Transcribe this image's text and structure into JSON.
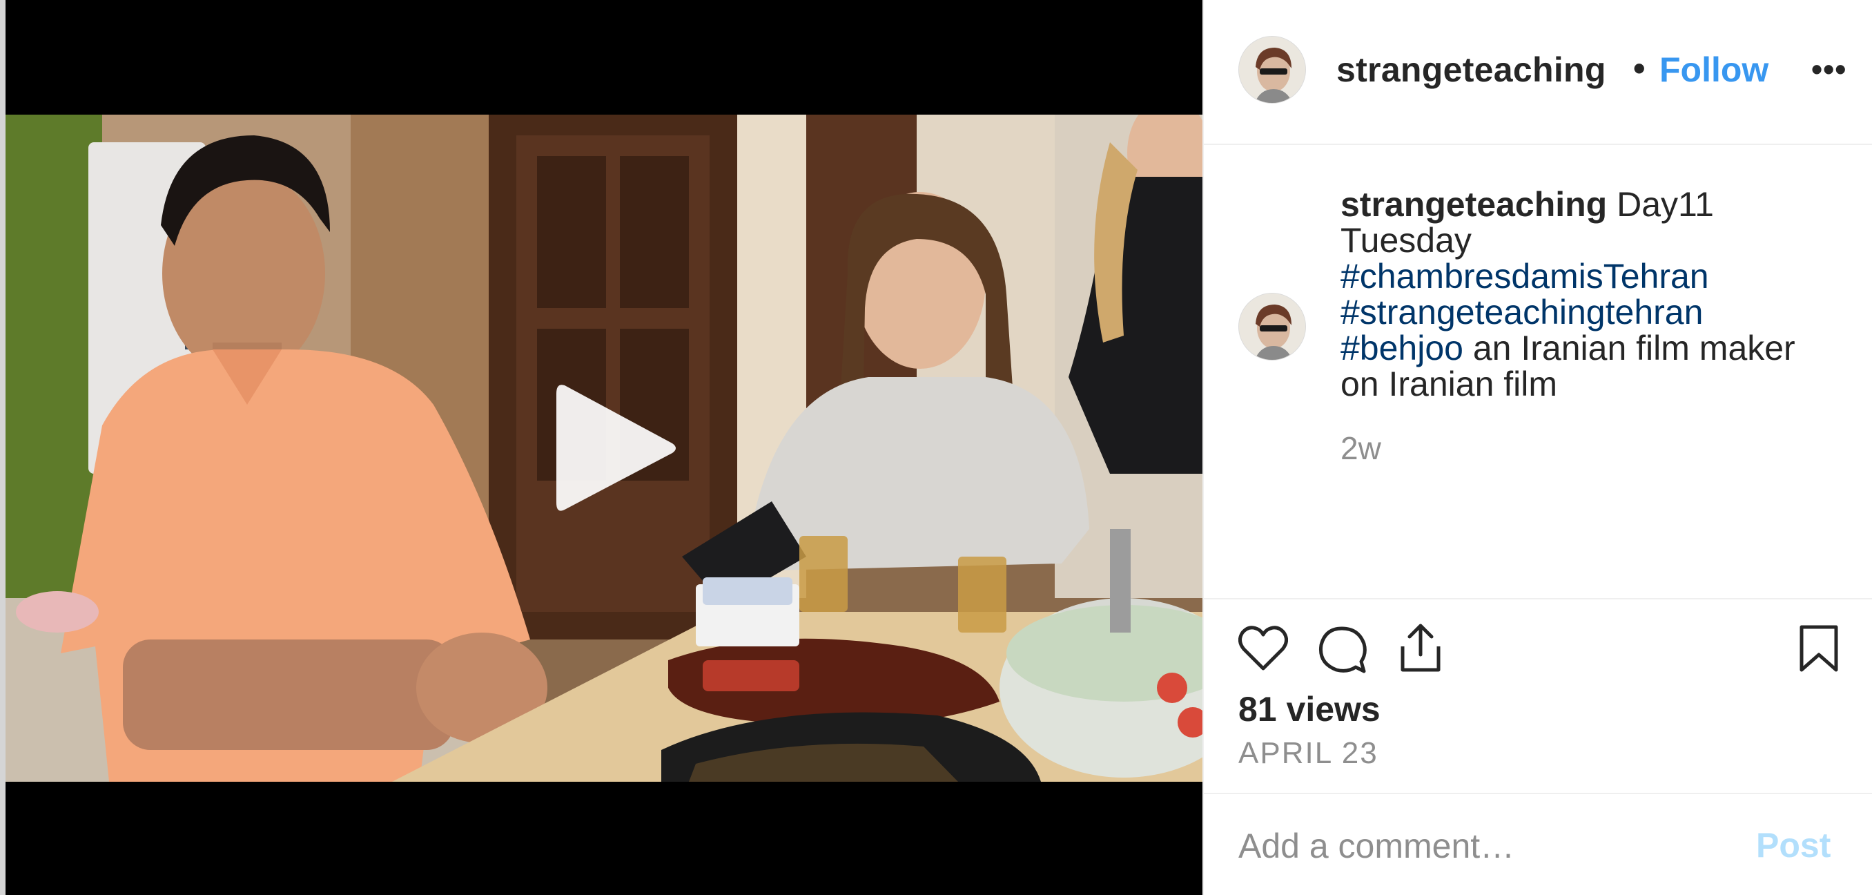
{
  "post": {
    "username": "strangeteaching",
    "separator": "•",
    "follow_label": "Follow",
    "more_icon": "more-options-icon",
    "more_glyph": "•••"
  },
  "caption": {
    "username": "strangeteaching",
    "text_start": " Day11 Tuesday ",
    "hashtags": [
      "#chambresdamisTehran",
      "#strangeteachingtehran",
      "#behjoo"
    ],
    "text_end": " an Iranian film maker on Iranian film",
    "time": "2w"
  },
  "actions": {
    "icons": [
      "heart-icon",
      "comment-icon",
      "share-icon",
      "bookmark-icon"
    ],
    "views": "81 views",
    "date": "APRIL 23"
  },
  "comment": {
    "placeholder": "Add a comment…",
    "post_label": "Post"
  },
  "colors": {
    "link_blue": "#3897f0",
    "hashtag": "#003569",
    "muted": "#8e8e8e",
    "post_disabled": "#b2dffc"
  }
}
